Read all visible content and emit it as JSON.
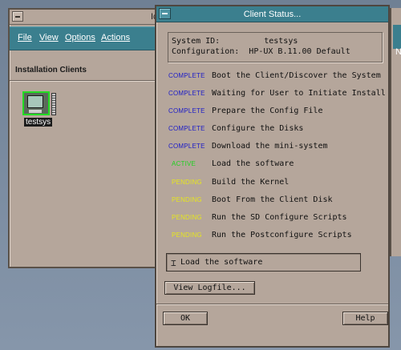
{
  "back_window": {
    "title_fragment": "Ic",
    "menu": [
      "File",
      "View",
      "Options",
      "Actions"
    ],
    "section_title": "Installation Clients",
    "client_label": "testsys"
  },
  "sliver_window": {
    "menu_fragment": "N"
  },
  "dialog": {
    "title": "Client Status...",
    "system_id_label": "System ID:",
    "system_id_value": "testsys",
    "configuration_label": "Configuration:",
    "configuration_value": "HP-UX B.11.00 Default",
    "tasks": [
      {
        "status": "COMPLETE",
        "label": "Boot the Client/Discover the System"
      },
      {
        "status": "COMPLETE",
        "label": "Waiting for User to Initiate Install"
      },
      {
        "status": "COMPLETE",
        "label": "Prepare the Config File"
      },
      {
        "status": "COMPLETE",
        "label": "Configure the Disks"
      },
      {
        "status": "COMPLETE",
        "label": "Download the mini-system"
      },
      {
        "status": "ACTIVE",
        "label": "Load the software"
      },
      {
        "status": "PENDING",
        "label": "Build the Kernel"
      },
      {
        "status": "PENDING",
        "label": "Boot From the Client Disk"
      },
      {
        "status": "PENDING",
        "label": "Run the SD Configure Scripts"
      },
      {
        "status": "PENDING",
        "label": "Run the Postconfigure Scripts"
      }
    ],
    "current_task": "Load the software",
    "view_logfile_label": "View Logfile...",
    "ok_label": "OK",
    "help_label": "Help"
  },
  "colors": {
    "complete": "#1c1cc8",
    "active": "#22d022",
    "pending": "#e6e61e",
    "titlebar": "#3b7f8e",
    "window_bg": "#b5a69b"
  }
}
